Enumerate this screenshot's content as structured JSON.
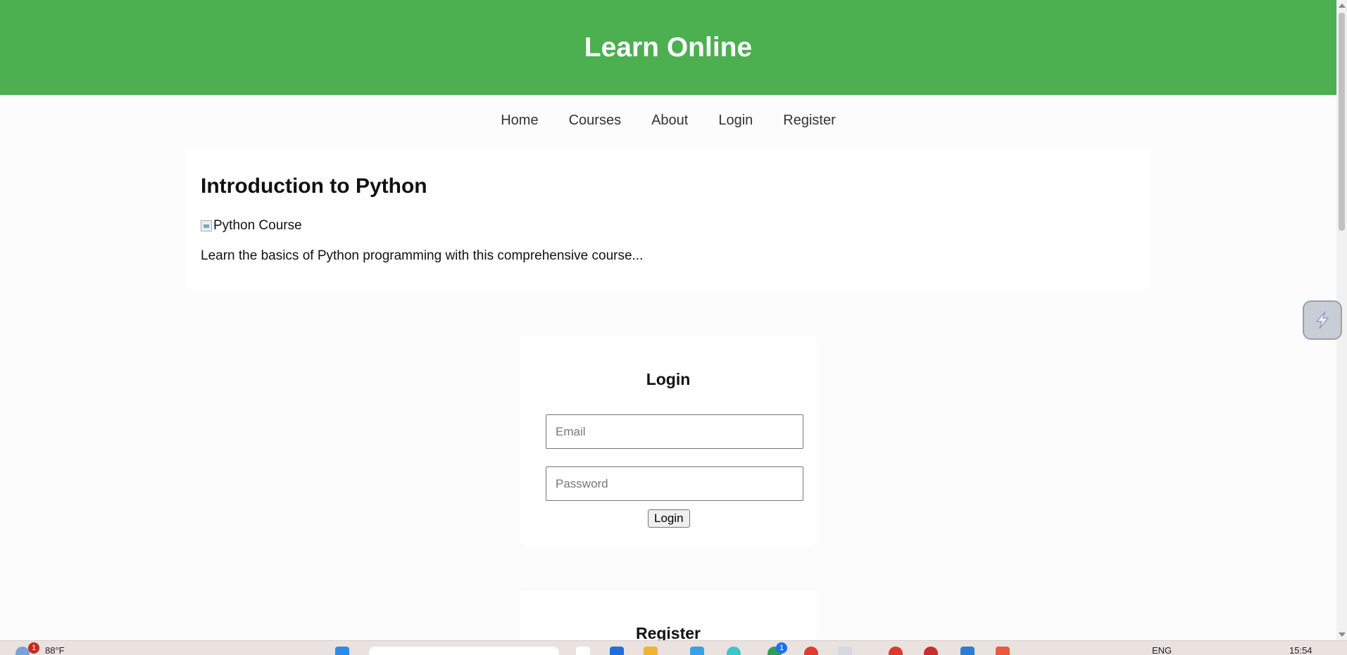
{
  "header": {
    "title": "Learn Online"
  },
  "nav": {
    "items": [
      "Home",
      "Courses",
      "About",
      "Login",
      "Register"
    ]
  },
  "course": {
    "title": "Introduction to Python",
    "image_alt": "Python Course",
    "description": "Learn the basics of Python programming with this comprehensive course..."
  },
  "login": {
    "title": "Login",
    "email_placeholder": "Email",
    "password_placeholder": "Password",
    "button_label": "Login"
  },
  "register": {
    "title": "Register"
  },
  "taskbar": {
    "weather_badge": "1",
    "weather": "88°F",
    "language": "ENG",
    "time": "15:54",
    "app_badge": "1"
  },
  "colors": {
    "header": "#4caf50",
    "page": "#fcfcfc",
    "card": "#ffffff"
  }
}
